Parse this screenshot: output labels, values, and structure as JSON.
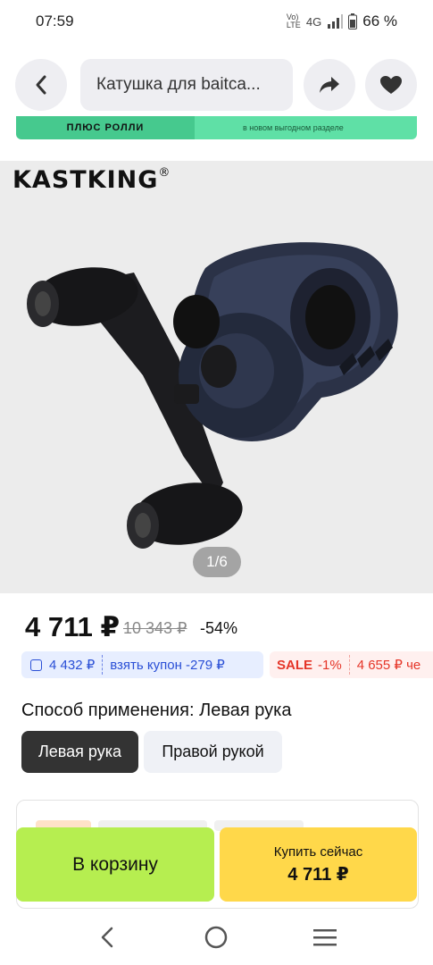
{
  "status_bar": {
    "time": "07:59",
    "network": "4G",
    "volte": "Vo) LTE",
    "battery": "66 %"
  },
  "header": {
    "search_text": "Катушка для baitca...",
    "back_icon": "chevron-left-icon",
    "share_icon": "share-arrow-icon",
    "favorite_icon": "heart-icon"
  },
  "banner": {
    "left_text": "ПЛЮС РОЛЛИ",
    "right_text": "в новом выгодном разделе"
  },
  "gallery": {
    "brand": "KASTKING",
    "brand_mark": "®",
    "counter": "1/6"
  },
  "price": {
    "current": "4 711 ₽",
    "old": "10 343 ₽",
    "discount": "-54%"
  },
  "coupon": {
    "price": "4 432 ₽",
    "action": "взять купон -279 ₽"
  },
  "sale": {
    "label": "SALE",
    "discount": "-1%",
    "price": "4 655 ₽ че"
  },
  "options": {
    "title": "Способ применения: Левая рука",
    "choices": [
      "Левая рука",
      "Правой рукой"
    ]
  },
  "actions": {
    "cart": "В корзину",
    "buy": "Купить сейчас",
    "buy_price": "4 711 ₽"
  },
  "colors": {
    "cart_button": "#b6ee50",
    "buy_button": "#ffd84a",
    "coupon_blue": "#2a4fd6",
    "sale_red": "#e53528"
  }
}
